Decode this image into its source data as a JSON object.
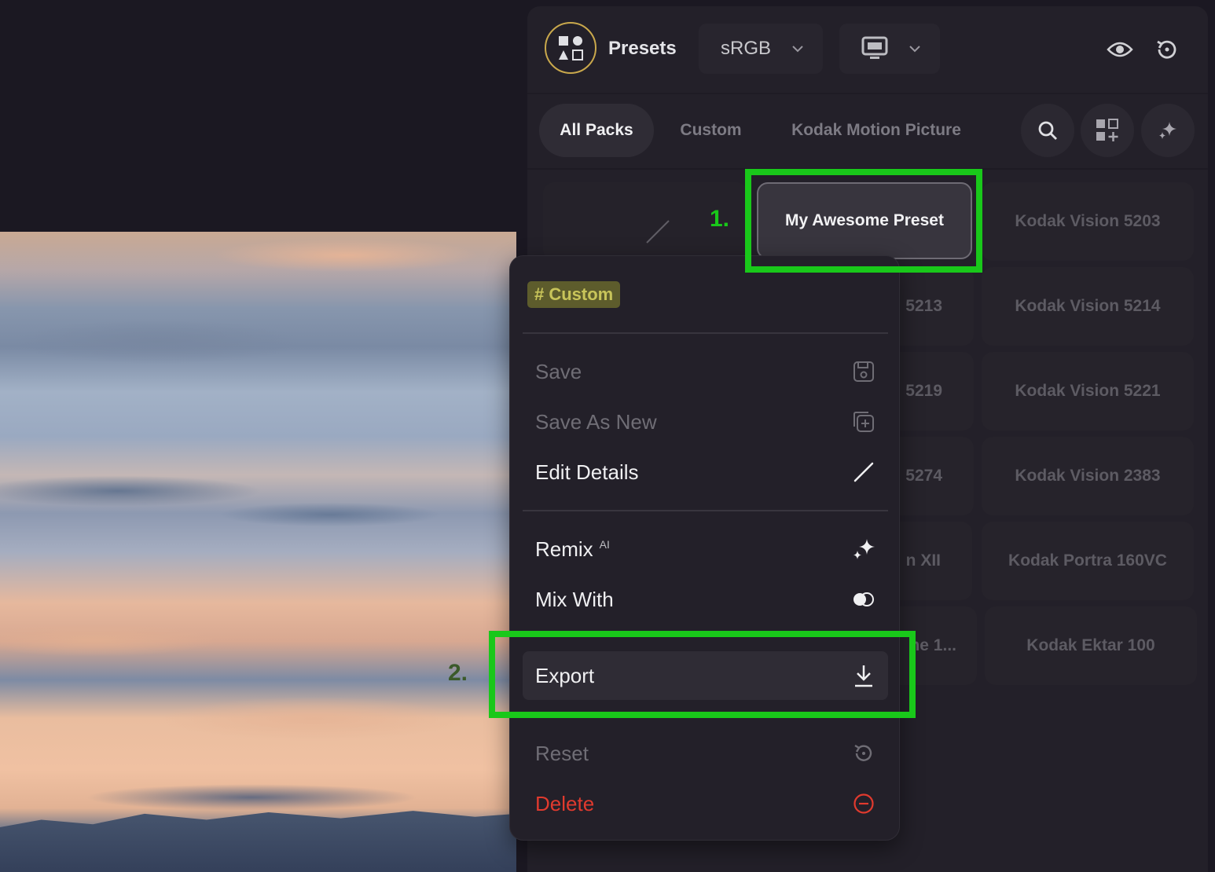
{
  "header": {
    "title": "Presets",
    "color_space": "sRGB"
  },
  "tabs": [
    {
      "label": "All Packs",
      "active": true
    },
    {
      "label": "Custom",
      "active": false
    },
    {
      "label": "Kodak Motion Picture",
      "active": false
    }
  ],
  "preset_grid": {
    "selected": "My Awesome Preset",
    "tiles": [
      "Kodak Vision 5203",
      "5213",
      "Kodak Vision 5214",
      "5219",
      "Kodak Vision 5221",
      "5274",
      "Kodak Vision 2383",
      "n XII",
      "Kodak Portra 160VC",
      "ne 1...",
      "Kodak Ektar 100"
    ]
  },
  "context_menu": {
    "tag": "# Custom",
    "items": [
      {
        "label": "Save",
        "icon": "save-icon",
        "state": "disabled"
      },
      {
        "label": "Save As New",
        "icon": "save-as-new-icon",
        "state": "disabled"
      },
      {
        "label": "Edit Details",
        "icon": "pencil-icon",
        "state": "enabled"
      },
      {
        "label": "Remix",
        "superscript": "AI",
        "icon": "sparkle-icon",
        "state": "enabled"
      },
      {
        "label": "Mix With",
        "icon": "mix-icon",
        "state": "enabled"
      },
      {
        "label": "Export",
        "icon": "download-icon",
        "state": "hover"
      },
      {
        "label": "Reset",
        "icon": "reset-icon",
        "state": "disabled"
      },
      {
        "label": "Delete",
        "icon": "minus-circle-icon",
        "state": "danger"
      }
    ]
  },
  "annotations": {
    "step1": "1.",
    "step2": "2.",
    "step1_color": "#19c81a",
    "step2_color": "#3b5a2a",
    "box_color": "#19c81a"
  },
  "colors": {
    "accent_tag_bg": "#5d5c2c",
    "accent_tag_text": "#c8c45a",
    "danger": "#e03a2e",
    "logo_ring": "#c9a84c"
  }
}
